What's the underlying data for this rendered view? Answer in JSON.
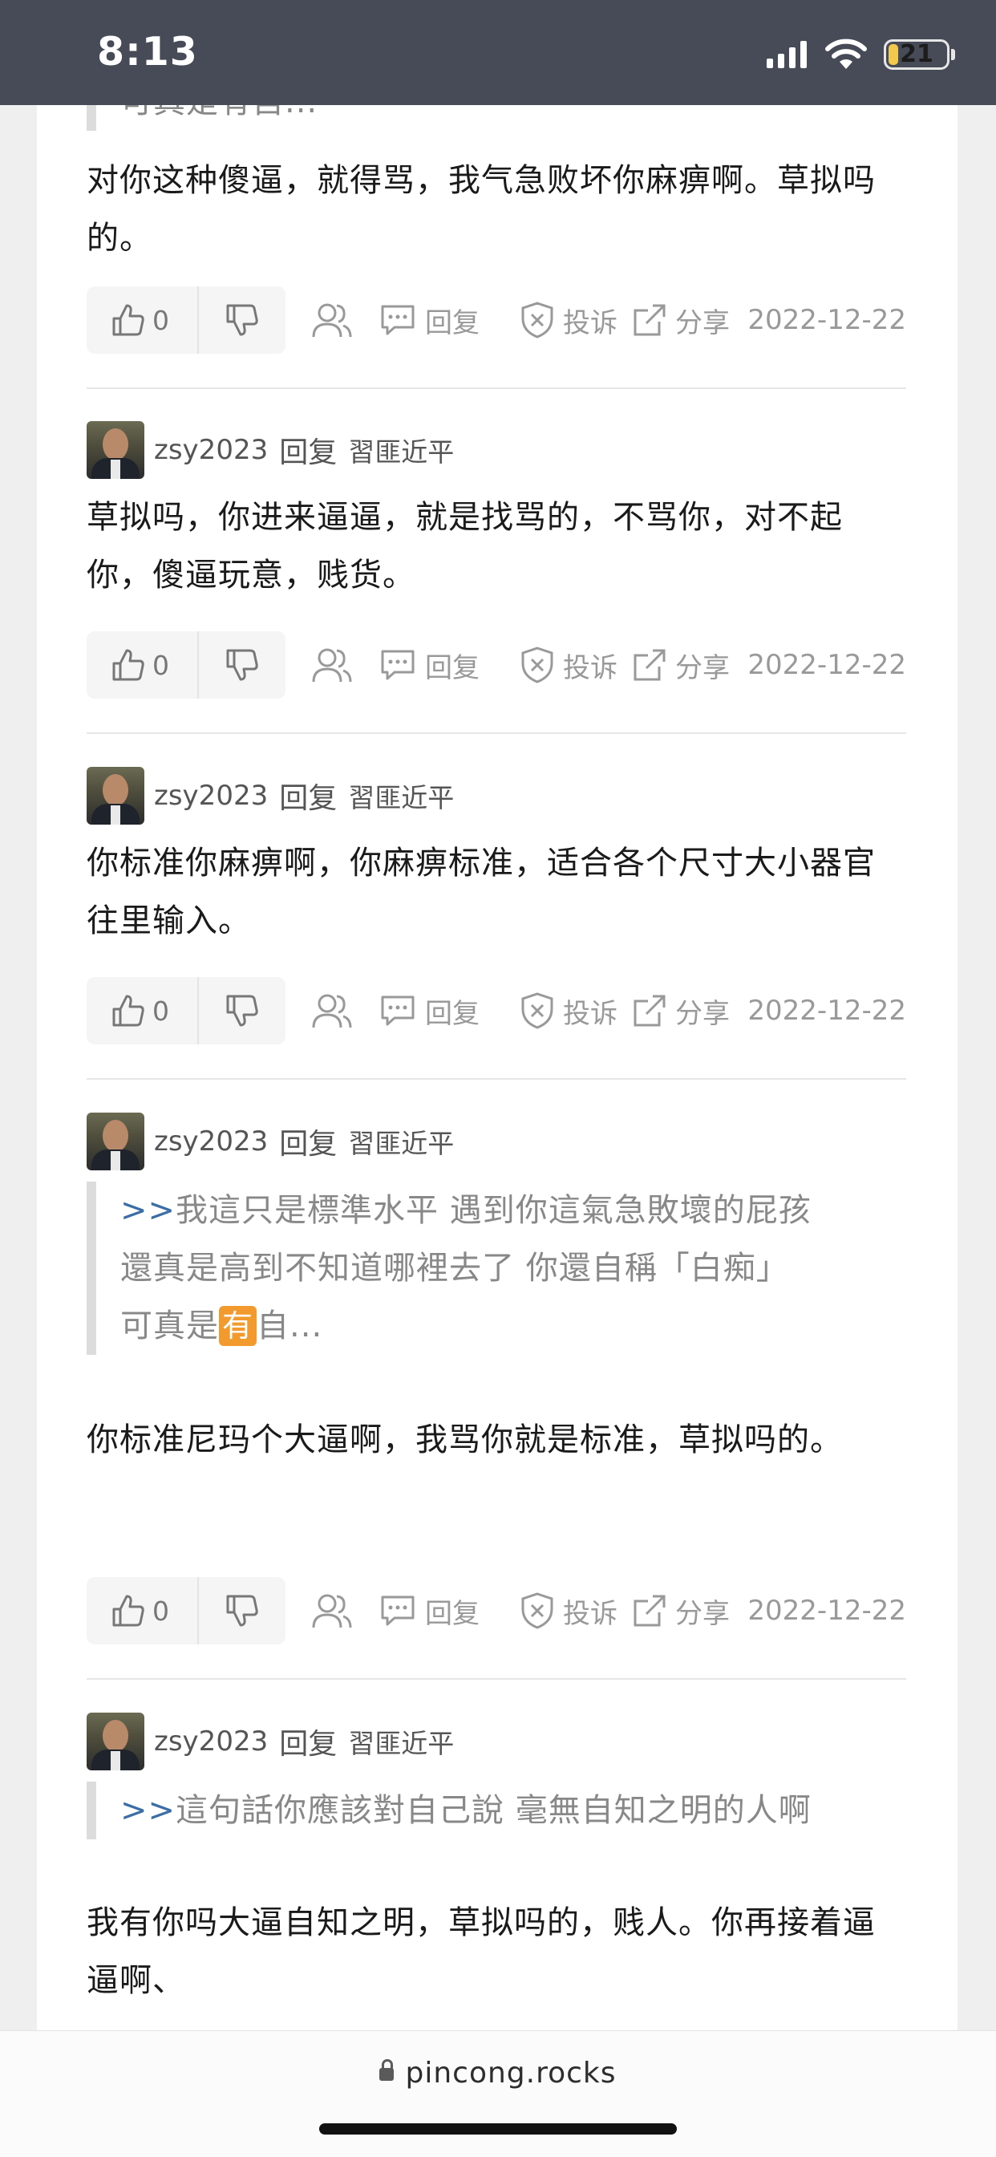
{
  "status_bar": {
    "time": "8:13",
    "battery": "21"
  },
  "colors": {
    "status_bar_bg": "#474b57",
    "quote_link": "#3a6ea5",
    "emoji_badge": "#f29a2e"
  },
  "top_partial_quote": "可真是有自...",
  "comments": [
    {
      "user": "",
      "reply_word": "",
      "target": "",
      "text": "对你这种傻逼，就得骂，我气急败坏你麻痹啊。草拟吗的。",
      "likes": "0",
      "reply_label": "回复",
      "report_label": "投诉",
      "share_label": "分享",
      "date": "2022-12-22"
    },
    {
      "user": "zsy2023",
      "reply_word": "回复",
      "target": "習匪近平",
      "text": "草拟吗，你进来逼逼，就是找骂的，不骂你，对不起你，傻逼玩意，贱货。",
      "likes": "0",
      "reply_label": "回复",
      "report_label": "投诉",
      "share_label": "分享",
      "date": "2022-12-22"
    },
    {
      "user": "zsy2023",
      "reply_word": "回复",
      "target": "習匪近平",
      "text": "你标准你麻痹啊，你麻痹标准，适合各个尺寸大小器官往里输入。",
      "likes": "0",
      "reply_label": "回复",
      "report_label": "投诉",
      "share_label": "分享",
      "date": "2022-12-22"
    },
    {
      "user": "zsy2023",
      "reply_word": "回复",
      "target": "習匪近平",
      "quote_prefix": ">>",
      "quote_line1": "我這只是標準水平 遇到你這氣急敗壞的屁孩",
      "quote_line2": "還真是高到不知道哪裡去了 你還自稱「白痴」",
      "quote_line3_a": "可真是",
      "quote_emoji": "有",
      "quote_line3_b": "自...",
      "text": "你标准尼玛个大逼啊，我骂你就是标准，草拟吗的。",
      "likes": "0",
      "reply_label": "回复",
      "report_label": "投诉",
      "share_label": "分享",
      "date": "2022-12-22"
    },
    {
      "user": "zsy2023",
      "reply_word": "回复",
      "target": "習匪近平",
      "quote_prefix": ">>",
      "quote_line1": "這句話你應該對自己說 毫無自知之明的人啊",
      "text": "我有你吗大逼自知之明，草拟吗的，贱人。你再接着逼逼啊、"
    }
  ],
  "browser": {
    "url": "pincong.rocks"
  }
}
